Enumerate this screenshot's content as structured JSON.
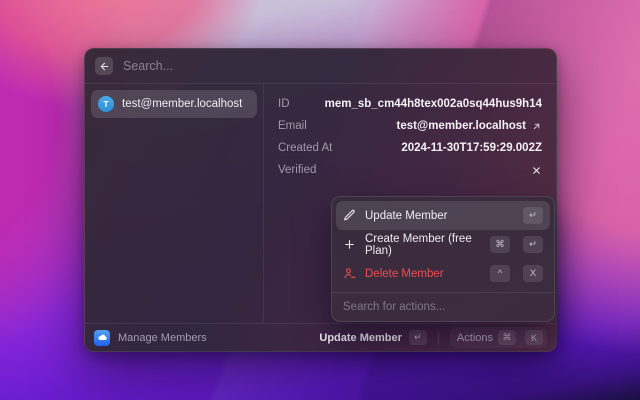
{
  "window": {
    "search_placeholder": "Search...",
    "results": [
      {
        "avatar_letter": "T",
        "label": "test@member.localhost"
      }
    ],
    "details": {
      "rows": [
        {
          "label": "ID",
          "value": "mem_sb_cm44h8tex002a0sq44hus9h14"
        },
        {
          "label": "Email",
          "value": "test@member.localhost"
        },
        {
          "label": "Created At",
          "value": "2024-11-30T17:59:29.002Z"
        },
        {
          "label": "Verified",
          "value": ""
        }
      ]
    },
    "actions_menu": {
      "items": [
        {
          "label": "Update Member",
          "shortcuts": [
            "↵"
          ]
        },
        {
          "label": "Create Member (free Plan)",
          "shortcuts": [
            "⌘",
            "↵"
          ]
        },
        {
          "label": "Delete Member",
          "shortcuts": [
            "^",
            "X"
          ]
        }
      ],
      "search_placeholder": "Search for actions..."
    },
    "footer": {
      "app_name": "Manage Members",
      "primary_label": "Update Member",
      "primary_shortcut": "↵",
      "actions_label": "Actions",
      "actions_shortcuts": [
        "⌘",
        "K"
      ]
    }
  },
  "colors": {
    "avatar_blue": "#3ba0e3",
    "app_icon_blue": "#2f7df0",
    "danger_red": "#ee4d53",
    "wallpaper_magenta": "#c52bb4",
    "wallpaper_pink": "#e070ae",
    "wallpaper_purple": "#8727d8"
  }
}
